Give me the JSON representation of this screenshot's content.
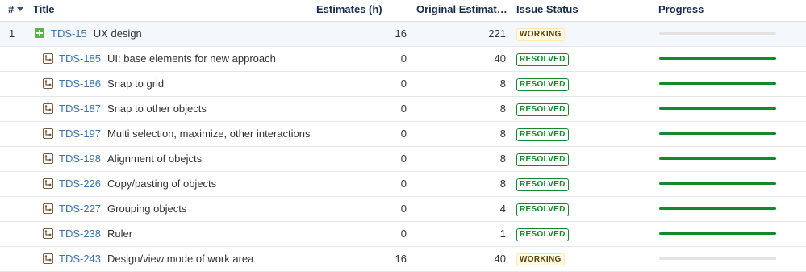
{
  "columns": {
    "num": "#",
    "title": "Title",
    "estimates": "Estimates (h)",
    "original": "Original Estimate (h)",
    "status": "Issue Status",
    "progress": "Progress"
  },
  "rows": [
    {
      "num": "1",
      "key": "TDS-15",
      "summary": "UX design",
      "estimate": "16",
      "original": "221",
      "status": "WORKING",
      "progress": 0.0,
      "icon": "story-plus-icon"
    },
    {
      "num": "",
      "key": "TDS-185",
      "summary": "UI: base elements for new approach",
      "estimate": "0",
      "original": "40",
      "status": "RESOLVED",
      "progress": 1.0,
      "icon": "subtask-icon"
    },
    {
      "num": "",
      "key": "TDS-186",
      "summary": "Snap to grid",
      "estimate": "0",
      "original": "8",
      "status": "RESOLVED",
      "progress": 1.0,
      "icon": "subtask-icon"
    },
    {
      "num": "",
      "key": "TDS-187",
      "summary": "Snap to other objects",
      "estimate": "0",
      "original": "8",
      "status": "RESOLVED",
      "progress": 1.0,
      "icon": "subtask-icon"
    },
    {
      "num": "",
      "key": "TDS-197",
      "summary": "Multi selection, maximize, other interactions",
      "estimate": "0",
      "original": "8",
      "status": "RESOLVED",
      "progress": 1.0,
      "icon": "subtask-icon"
    },
    {
      "num": "",
      "key": "TDS-198",
      "summary": "Alignment of obejcts",
      "estimate": "0",
      "original": "8",
      "status": "RESOLVED",
      "progress": 1.0,
      "icon": "subtask-icon"
    },
    {
      "num": "",
      "key": "TDS-226",
      "summary": "Copy/pasting of objects",
      "estimate": "0",
      "original": "8",
      "status": "RESOLVED",
      "progress": 1.0,
      "icon": "subtask-icon"
    },
    {
      "num": "",
      "key": "TDS-227",
      "summary": "Grouping objects",
      "estimate": "0",
      "original": "4",
      "status": "RESOLVED",
      "progress": 1.0,
      "icon": "subtask-icon"
    },
    {
      "num": "",
      "key": "TDS-238",
      "summary": "Ruler",
      "estimate": "0",
      "original": "1",
      "status": "RESOLVED",
      "progress": 1.0,
      "icon": "subtask-icon"
    },
    {
      "num": "",
      "key": "TDS-243",
      "summary": "Design/view mode of work area",
      "estimate": "16",
      "original": "40",
      "status": "WORKING",
      "progress": 0.0,
      "icon": "subtask-icon"
    }
  ],
  "colors": {
    "link": "#3b73af",
    "resolved": "#14892c",
    "working_text": "#594300",
    "progress_track": "#e3e3e3"
  }
}
